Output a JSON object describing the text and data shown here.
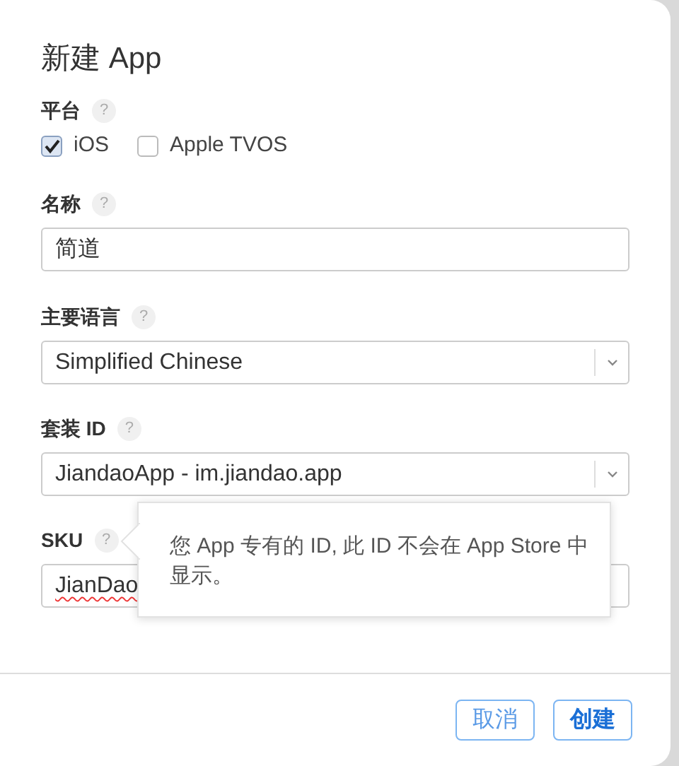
{
  "dialog": {
    "title": "新建 App"
  },
  "platform": {
    "label": "平台",
    "help": "?",
    "options": [
      {
        "label": "iOS",
        "checked": true
      },
      {
        "label": "Apple TVOS",
        "checked": false
      }
    ]
  },
  "fields": [
    {
      "kind": "text",
      "label": "名称",
      "help": "?",
      "value": "简道",
      "misspelled": false
    },
    {
      "kind": "select",
      "label": "主要语言",
      "help": "?",
      "value": "Simplified Chinese"
    },
    {
      "kind": "select",
      "label": "套装 ID",
      "help": "?",
      "value": "JiandaoApp - im.jiandao.app"
    },
    {
      "kind": "text",
      "label": "SKU",
      "help": "?",
      "value": "JianDao",
      "misspelled": true
    }
  ],
  "tooltip": {
    "text": "您 App 专有的 ID, 此 ID 不会在 App Store 中显示。"
  },
  "buttons": [
    {
      "label": "取消",
      "primary": false
    },
    {
      "label": "创建",
      "primary": true
    }
  ]
}
